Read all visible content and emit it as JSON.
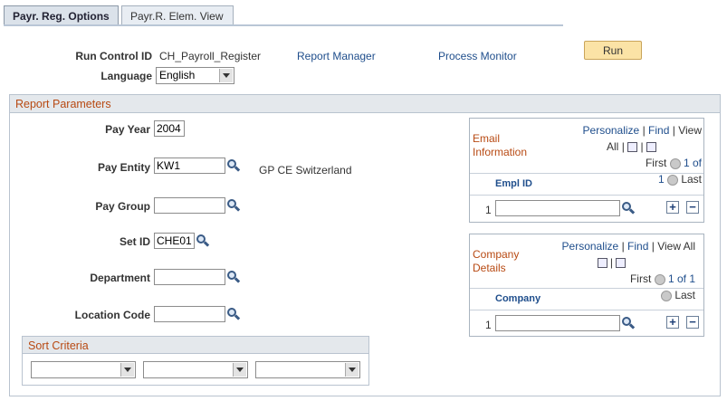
{
  "tabs": [
    {
      "label": "Payr. Reg. Options",
      "active": true
    },
    {
      "label": "Payr.R. Elem. View",
      "active": false
    }
  ],
  "header": {
    "run_control_label": "Run Control ID",
    "run_control_value": "CH_Payroll_Register",
    "report_manager": "Report Manager",
    "process_monitor": "Process Monitor",
    "run_button": "Run",
    "language_label": "Language",
    "language_value": "English"
  },
  "report_params": {
    "title": "Report Parameters",
    "pay_year_label": "Pay Year",
    "pay_year_value": "2004",
    "pay_entity_label": "Pay Entity",
    "pay_entity_value": "KW1",
    "pay_entity_desc": "GP CE Switzerland",
    "pay_group_label": "Pay Group",
    "pay_group_value": "",
    "set_id_label": "Set ID",
    "set_id_value": "CHE01",
    "department_label": "Department",
    "department_value": "",
    "location_label": "Location Code",
    "location_value": ""
  },
  "sort": {
    "title": "Sort Criteria",
    "values": [
      "",
      "",
      ""
    ]
  },
  "email_grid": {
    "title_line1": "Email",
    "title_line2": "Information",
    "personalize": "Personalize",
    "sep1": "|",
    "find": "Find",
    "sep2": "|",
    "view": "View",
    "all": "All",
    "sep3": "|",
    "sep4": "|",
    "first": "First",
    "range": "1 of",
    "range_end": "1",
    "last": "Last",
    "column": "Empl ID",
    "row_num": "1",
    "row_value": ""
  },
  "company_grid": {
    "title_line1": "Company",
    "title_line2": "Details",
    "personalize": "Personalize",
    "sep1": "|",
    "find": "Find",
    "sep2": "|",
    "view_all": "View All",
    "sep3": "|",
    "first": "First",
    "range": "1 of 1",
    "last": "Last",
    "column": "Company",
    "row_num": "1",
    "row_value": ""
  },
  "icons": {
    "lookup": "magnifier-icon",
    "plus": "+",
    "minus": "−"
  }
}
